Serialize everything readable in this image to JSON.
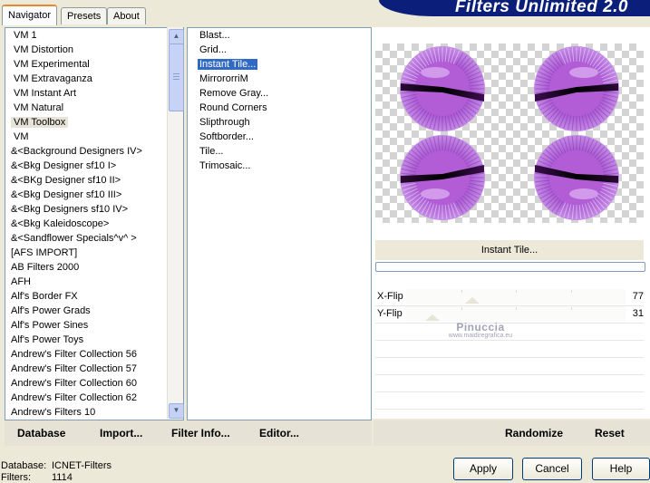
{
  "tabs": {
    "navigator": "Navigator",
    "presets": "Presets",
    "about": "About"
  },
  "title": "Filters Unlimited 2.0",
  "categories": [
    "VM 1",
    "VM Distortion",
    "VM Experimental",
    "VM Extravaganza",
    "VM Instant Art",
    "VM Natural",
    "VM Toolbox",
    "VM",
    "&<Background Designers IV>",
    "&<Bkg Designer sf10 I>",
    "&<BKg Designer sf10 II>",
    "&<Bkg Designer sf10 III>",
    "&<Bkg Designers sf10 IV>",
    "&<Bkg Kaleidoscope>",
    "&<Sandflower Specials^v^ >",
    "[AFS IMPORT]",
    "AB Filters 2000",
    "AFH",
    "Alf's Border FX",
    "Alf's Power Grads",
    "Alf's Power Sines",
    "Alf's Power Toys",
    "Andrew's Filter Collection 56",
    "Andrew's Filter Collection 57",
    "Andrew's Filter Collection 60",
    "Andrew's Filter Collection 62",
    "Andrew's Filters 10"
  ],
  "selected_category": "VM Toolbox",
  "filters": [
    "Blast...",
    "Grid...",
    "Instant Tile...",
    "MirrororriM",
    "Remove Gray...",
    "Round Corners",
    "Slipthrough",
    "Softborder...",
    "Tile...",
    "Trimosaic..."
  ],
  "selected_filter": "Instant Tile...",
  "filter_name": "Instant Tile...",
  "params": [
    {
      "label": "X-Flip",
      "value": "77",
      "level": 0.3
    },
    {
      "label": "Y-Flip",
      "value": "31",
      "level": 0.12
    }
  ],
  "watermark": {
    "line1": "Pinuccia",
    "line2": "www.maidiregrafica.eu"
  },
  "toolbar": {
    "database": "Database",
    "import": "Import...",
    "filter_info": "Filter Info...",
    "editor": "Editor...",
    "randomize": "Randomize",
    "reset": "Reset"
  },
  "info": {
    "database_label": "Database:",
    "database_value": "ICNET-Filters",
    "filters_label": "Filters:",
    "filters_value": "1114"
  },
  "buttons": {
    "apply": "Apply",
    "cancel": "Cancel",
    "help": "Help"
  },
  "colors": {
    "banner": "#0b1f7a",
    "selection": "#316ac5",
    "tile": "#b25cd6"
  }
}
